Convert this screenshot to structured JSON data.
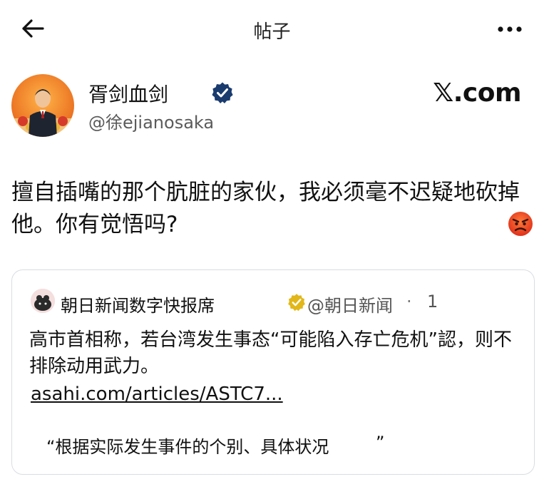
{
  "header": {
    "title": "帖子",
    "back_icon": "arrow-left-icon",
    "more_icon": "more-horizontal-icon"
  },
  "post": {
    "display_name": "胥剑血剑",
    "handle": "@徐ejianosaka",
    "verified_icon": "verified-badge-icon",
    "site_mark": "𝕏.com",
    "body": "擅自插嘴的那个肮脏的家伙，我必须毫不迟疑地砍掉他。你有觉悟吗?",
    "emoji": "angry-face-icon"
  },
  "quote": {
    "name": "朝日新闻数字快报席",
    "handle": "@朝日新闻",
    "separator": "·",
    "time": "1",
    "text": "高市首相称，若台湾发生事态“可能陷入存亡危机”認，则不排除动用武力。",
    "link": "asahi.com/articles/ASTC7...",
    "quote_text": "“根据实际发生事件的个别、具体状况",
    "quote_close": "”"
  },
  "colors": {
    "verified_blue": "#1d9bf0",
    "gold_badge": "#e2b719",
    "handle_gray": "#5b5b5b",
    "card_border": "#d9dde2"
  }
}
